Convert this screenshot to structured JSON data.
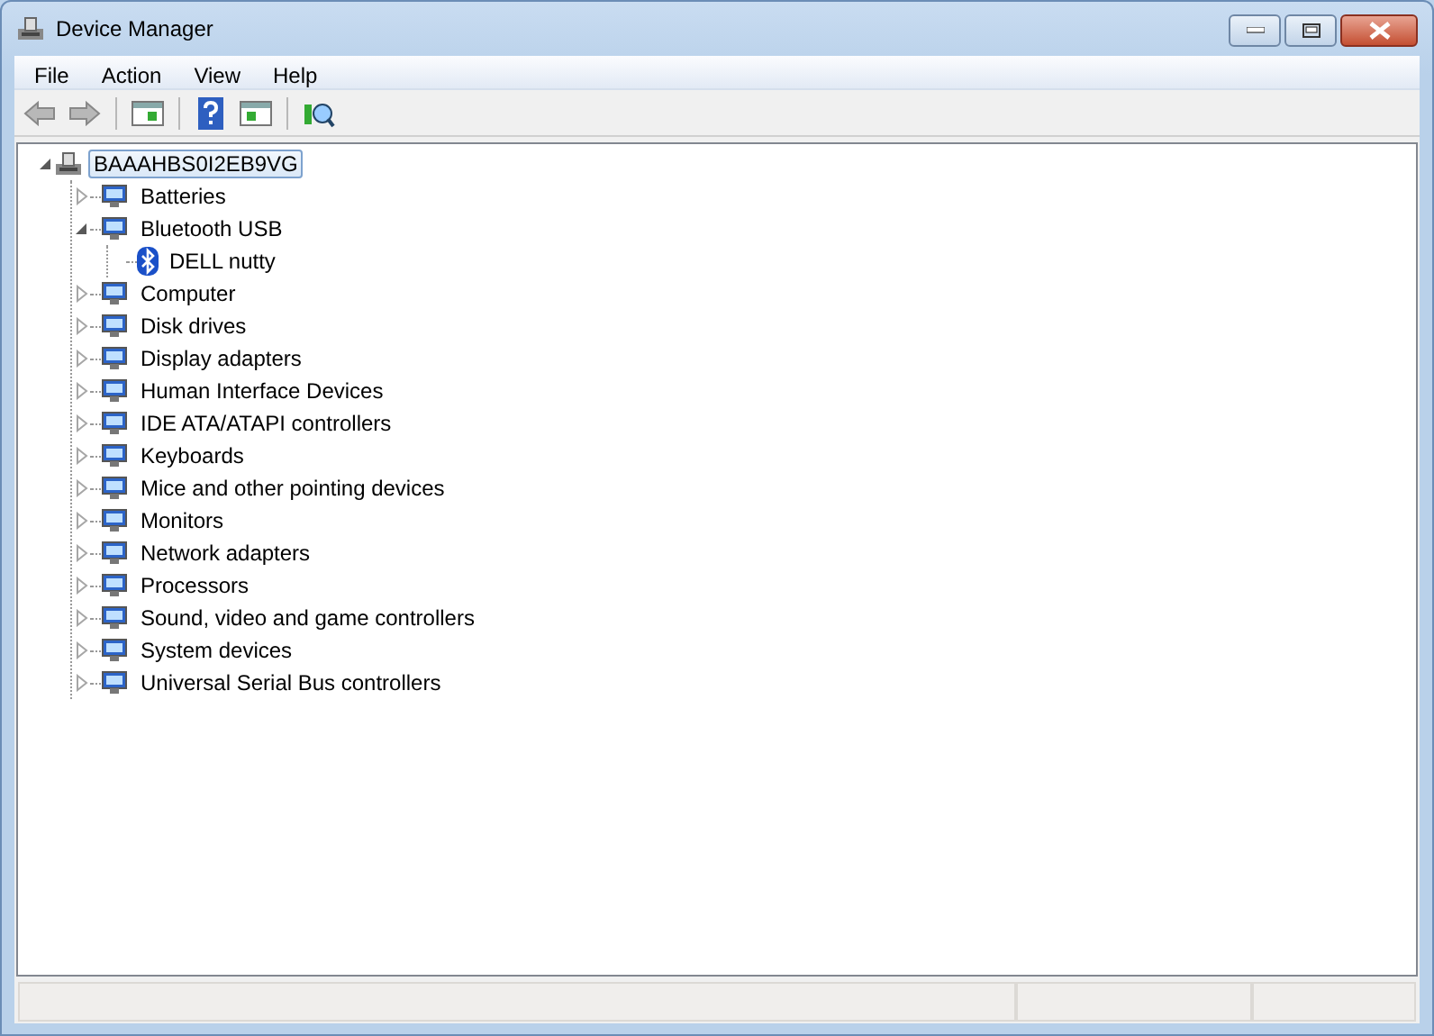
{
  "window": {
    "title": "Device Manager"
  },
  "menu": [
    "File",
    "Action",
    "View",
    "Help"
  ],
  "tree": [
    {
      "label": "BAAAHBS0I2EB9VG",
      "expanded": true,
      "selected": true,
      "children": [
        {
          "label": "Batteries",
          "expanded": false,
          "selected": false
        },
        {
          "label": "Bluetooth USB",
          "expanded": true,
          "selected": false,
          "children": [
            {
              "label": "DELL nutty",
              "selected": false
            }
          ]
        },
        {
          "label": "Computer",
          "expanded": false,
          "selected": false
        },
        {
          "label": "Disk drives",
          "expanded": false,
          "selected": false
        },
        {
          "label": "Display adapters",
          "expanded": false,
          "selected": false
        },
        {
          "label": "Human Interface Devices",
          "expanded": false,
          "selected": false
        },
        {
          "label": "IDE ATA/ATAPI controllers",
          "expanded": false,
          "selected": false
        },
        {
          "label": "Keyboards",
          "expanded": false,
          "selected": false
        },
        {
          "label": "Mice and other pointing devices",
          "expanded": false,
          "selected": false
        },
        {
          "label": "Monitors",
          "expanded": false,
          "selected": false
        },
        {
          "label": "Network adapters",
          "expanded": false,
          "selected": false
        },
        {
          "label": "Processors",
          "expanded": false,
          "selected": false
        },
        {
          "label": "Sound, video and game controllers",
          "expanded": false,
          "selected": false
        },
        {
          "label": "System devices",
          "expanded": false,
          "selected": false
        },
        {
          "label": "Universal Serial Bus controllers",
          "expanded": false,
          "selected": false
        }
      ]
    }
  ]
}
